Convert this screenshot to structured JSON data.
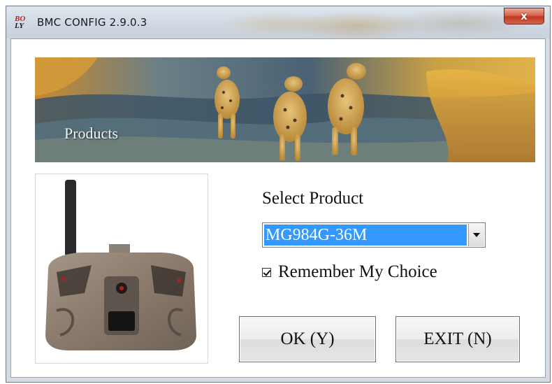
{
  "window": {
    "title": "BMC CONFIG 2.9.0.3",
    "icon_text": [
      "BO",
      "LY"
    ],
    "close_label": "x"
  },
  "banner": {
    "label": "Products"
  },
  "product": {
    "select_label": "Select Product",
    "selected_value": "MG984G-36M",
    "remember_label": "Remember My Choice",
    "remember_checked": true
  },
  "buttons": {
    "ok_label": "OK (Y)",
    "exit_label": "EXIT (N)"
  },
  "colors": {
    "selection": "#3399ff",
    "close_button": "#c2381f"
  }
}
